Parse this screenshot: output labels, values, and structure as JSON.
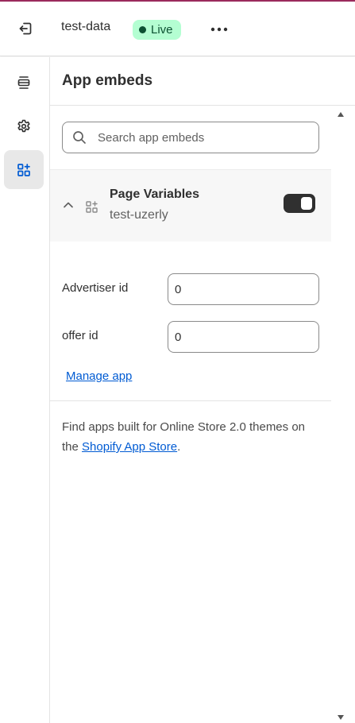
{
  "topbar": {
    "theme_name": "test-data",
    "status_badge": "Live"
  },
  "panel": {
    "title": "App embeds",
    "search": {
      "placeholder": "Search app embeds",
      "value": ""
    },
    "embed": {
      "name": "Page Variables",
      "subtitle": "test-uzerly",
      "enabled": true,
      "fields": [
        {
          "label": "Advertiser id",
          "value": "0"
        },
        {
          "label": "offer id",
          "value": "0"
        }
      ],
      "manage_link": "Manage app"
    },
    "footer": {
      "text_before": "Find apps built for Online Store 2.0 themes on the ",
      "link": "Shopify App Store",
      "text_after": "."
    }
  },
  "colors": {
    "accent_top": "#9b2a5c",
    "live_badge_bg": "#b4fed2",
    "live_badge_text": "#0c5132",
    "link": "#005bd3",
    "active_icon": "#005bd3"
  },
  "icons": {
    "exit": "exit-icon",
    "more": "more-horizontal-icon",
    "sections": "sections-icon",
    "settings": "gear-icon",
    "app_embeds": "app-embed-icon",
    "search": "search-icon",
    "collapse": "chevron-up-icon",
    "app": "app-icon"
  }
}
